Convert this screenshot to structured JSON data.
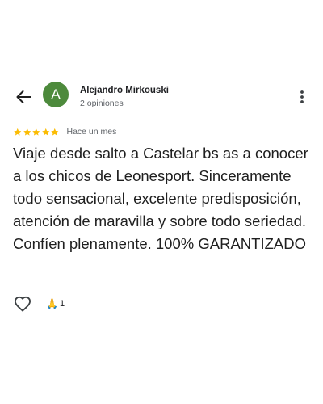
{
  "header": {
    "author_name": "Alejandro Mirkouski",
    "author_meta": "2 opiniones",
    "avatar_initial": "A"
  },
  "review": {
    "star_count": 5,
    "date": "Hace un mes",
    "text": "Viaje desde salto a Castelar bs as a conocer a los chicos de Leonesport. Sinceramente todo sensacional, excelente predisposición, atención de maravilla y sobre todo seriedad. Confíen plenamente. 100% GARANTIZADO"
  },
  "actions": {
    "reaction_emoji": "🙏",
    "reaction_count": "1"
  },
  "colors": {
    "avatar_bg": "#4d8a3c",
    "star": "#fbbc04",
    "text_primary": "#1f1f1f",
    "text_secondary": "#5f6368"
  },
  "icons": [
    "back-arrow-icon",
    "more-vert-icon",
    "star-icon",
    "heart-outline-icon",
    "folded-hands-icon"
  ]
}
